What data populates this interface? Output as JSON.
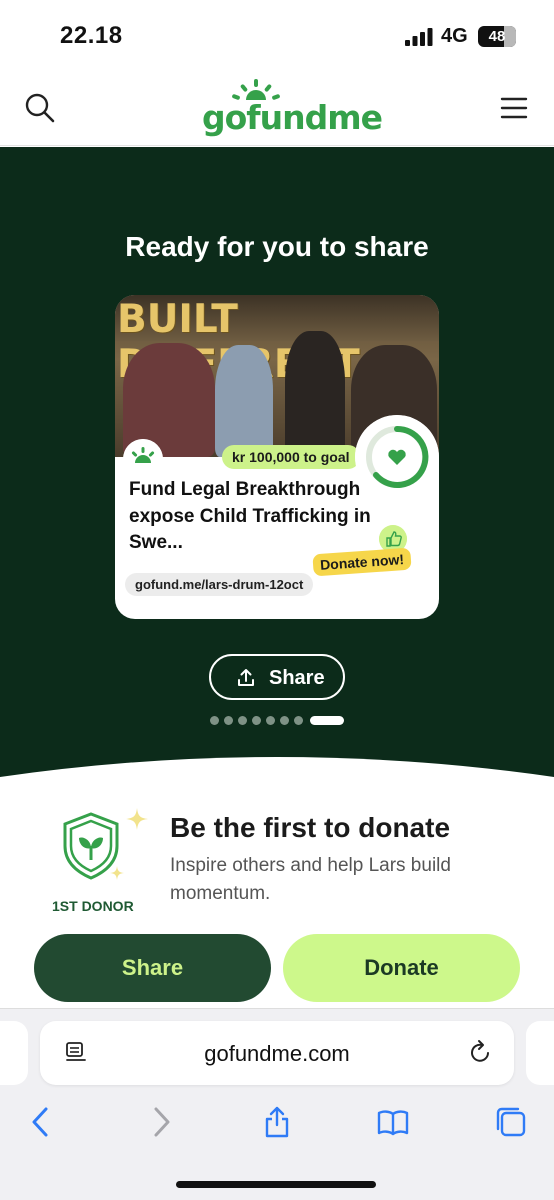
{
  "status_bar": {
    "time": "22.18",
    "network": "4G",
    "battery": "48"
  },
  "header": {
    "logo": "gofundme",
    "search_icon": "search-icon",
    "menu_icon": "hamburger-menu-icon"
  },
  "hero": {
    "title": "Ready for you to share",
    "card": {
      "banner_text": "BUILT DIFFERENT",
      "goal": "kr 100,000 to goal",
      "progress": 0.0,
      "title": "Fund Legal Breakthrough expose Child Trafficking in Swe...",
      "cta": "Donate now!",
      "short_url": "gofund.me/lars-drum-12oct"
    },
    "share_label": "Share",
    "carousel": {
      "count": 8,
      "active_index": 7
    }
  },
  "first_donor": {
    "badge_label": "1ST DONOR",
    "title": "Be the first to donate",
    "subtitle": "Inspire others and help Lars build momentum."
  },
  "actions": {
    "share_label": "Share",
    "donate_label": "Donate"
  },
  "browser": {
    "url": "gofundme.com"
  },
  "colors": {
    "brand_green": "#35a14a",
    "hero_bg": "#0c2b1a",
    "accent_lime": "#cdf88b",
    "dark_button": "#224a31"
  }
}
